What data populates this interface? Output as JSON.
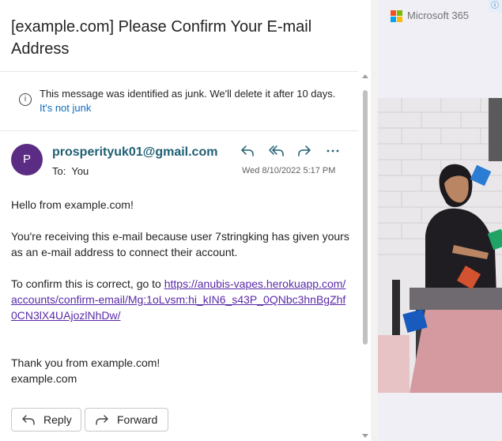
{
  "message": {
    "subject": "[example.com] Please Confirm Your E-mail Address",
    "junk_notice": "This message was identified as junk. We'll delete it after 10 days.",
    "junk_link": "It's not junk",
    "sender_initial": "P",
    "sender": "prosperityuk01@gmail.com",
    "to_label": "To:",
    "to_value": "You",
    "date": "Wed 8/10/2022 5:17 PM",
    "body": {
      "greeting": "Hello from example.com!",
      "para1": "You're receiving this e-mail because user 7stringking has given yours as an e-mail address to connect their account.",
      "para2_prefix": "To confirm this is correct, go to ",
      "link": "https://anubis-vapes.herokuapp.com/accounts/confirm-email/Mg:1oLvsm:hi_kIN6_s43P_0QNbc3hnBgZhf0CN3lX4UAjozlNhDw/",
      "thanks": "Thank you from example.com!",
      "signature": "example.com"
    },
    "actions": {
      "reply": "Reply",
      "forward": "Forward"
    },
    "icons": [
      "info-icon",
      "reply-icon",
      "reply-all-icon",
      "forward-icon",
      "more-icon"
    ]
  },
  "ad": {
    "brand": "Microsoft 365",
    "badge": "ⓘ",
    "brand_colors": [
      "#f25022",
      "#7fba00",
      "#00a4ef",
      "#ffb900"
    ]
  }
}
